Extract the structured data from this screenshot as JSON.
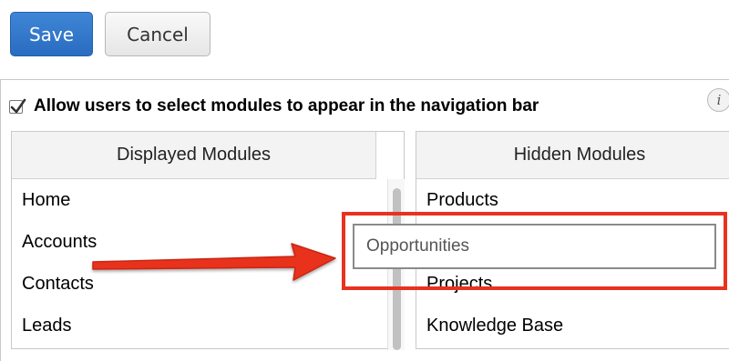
{
  "toolbar": {
    "save_label": "Save",
    "cancel_label": "Cancel"
  },
  "settings": {
    "allow_select_label": "Allow users to select modules to appear in the navigation bar",
    "allow_select_checked": true,
    "info_icon_glyph": "i"
  },
  "displayed_modules": {
    "header": "Displayed Modules",
    "items": [
      "Home",
      "Accounts",
      "Contacts",
      "Leads"
    ]
  },
  "hidden_modules": {
    "header": "Hidden Modules",
    "items": [
      "Products",
      "",
      "Projects",
      "Knowledge Base"
    ]
  },
  "dragging": {
    "label": "Opportunities"
  },
  "colors": {
    "primary_button": "#2a6cc0",
    "annotation_red": "#e8321f"
  },
  "icons": {
    "checkbox": "checkmark-icon",
    "info": "info-icon",
    "annotation": "red-arrow-icon"
  }
}
